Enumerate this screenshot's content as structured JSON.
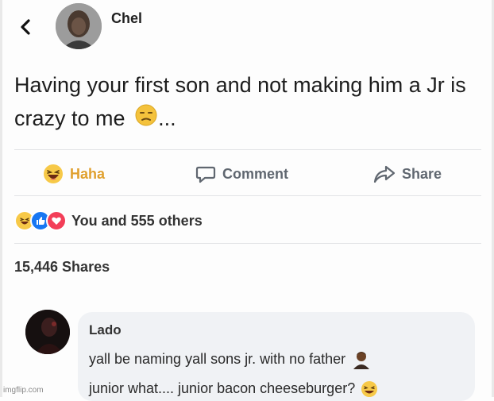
{
  "post": {
    "author": "Chel",
    "text": "Having your first son and not making him a Jr is crazy to me",
    "text_suffix": "...",
    "emoji": "unamused-face-icon"
  },
  "actions": {
    "haha_label": "Haha",
    "comment_label": "Comment",
    "share_label": "Share"
  },
  "reactions": {
    "count_text": "You and 555 others",
    "icons": [
      "haha-reaction-icon",
      "like-reaction-icon",
      "love-reaction-icon"
    ]
  },
  "shares": {
    "text": "15,446 Shares"
  },
  "comment": {
    "author": "Lado",
    "line1": "yall be naming yall sons jr. with no father",
    "line2": "junior what.... junior bacon cheeseburger?"
  },
  "watermark": "imgflip.com",
  "colors": {
    "haha": "#e0a02e",
    "like": "#1877f2",
    "love": "#f33e58",
    "muted_text": "#606770",
    "bubble": "#f0f2f5"
  }
}
